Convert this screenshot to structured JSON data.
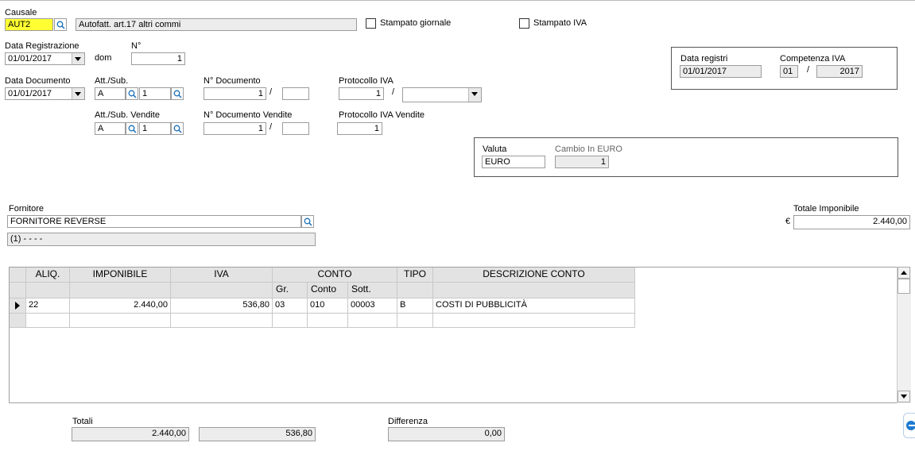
{
  "causale": {
    "label": "Causale",
    "code": "AUT2",
    "description": "Autofatt. art.17 altri commi"
  },
  "flags": {
    "stampato_giornale": "Stampato giornale",
    "stampato_iva": "Stampato IVA"
  },
  "registrazione": {
    "label": "Data Registrazione",
    "date": "01/01/2017",
    "day": "dom",
    "num_label": "N°",
    "num": "1"
  },
  "documento": {
    "date_label": "Data Documento",
    "date": "01/01/2017",
    "att_label": "Att./Sub.",
    "att": "A",
    "sub": "1",
    "num_label": "N° Documento",
    "num": "1",
    "sep": "/",
    "suffix": "",
    "prot_label": "Protocollo IVA",
    "prot": "1",
    "prot_sep": "/",
    "prot_series": ""
  },
  "vendite": {
    "att_label": "Att./Sub. Vendite",
    "att": "A",
    "sub": "1",
    "num_label": "N° Documento Vendite",
    "num": "1",
    "sep": "/",
    "suffix": "",
    "prot_label": "Protocollo IVA Vendite",
    "prot": "1"
  },
  "registri": {
    "date_label": "Data registri",
    "date": "01/01/2017",
    "comp_label": "Competenza IVA",
    "comp_month": "01",
    "comp_sep": "/",
    "comp_year": "2017"
  },
  "valuta": {
    "label": "Valuta",
    "value": "EURO",
    "cambio_label": "Cambio In EURO",
    "cambio": "1"
  },
  "fornitore": {
    "label": "Fornitore",
    "name": "FORNITORE REVERSE",
    "info": "(1) -  -   -  -"
  },
  "totale_imponibile": {
    "label": "Totale Imponibile",
    "currency": "€",
    "value": "2.440,00"
  },
  "grid": {
    "headers": {
      "aliq": "ALIQ.",
      "imponibile": "IMPONIBILE",
      "iva": "IVA",
      "conto": "CONTO",
      "tipo": "TIPO",
      "descr": "DESCRIZIONE CONTO"
    },
    "subheaders": {
      "gr": "Gr.",
      "conto": "Conto",
      "sott": "Sott."
    },
    "rows": [
      {
        "aliq": "22",
        "imponibile": "2.440,00",
        "iva": "536,80",
        "gr": "03",
        "conto": "010",
        "sott": "00003",
        "tipo": "B",
        "descr": "COSTI DI PUBBLICITÀ"
      }
    ]
  },
  "totali": {
    "label": "Totali",
    "imponibile": "2.440,00",
    "iva": "536,80",
    "diff_label": "Differenza",
    "diff": "0,00"
  }
}
